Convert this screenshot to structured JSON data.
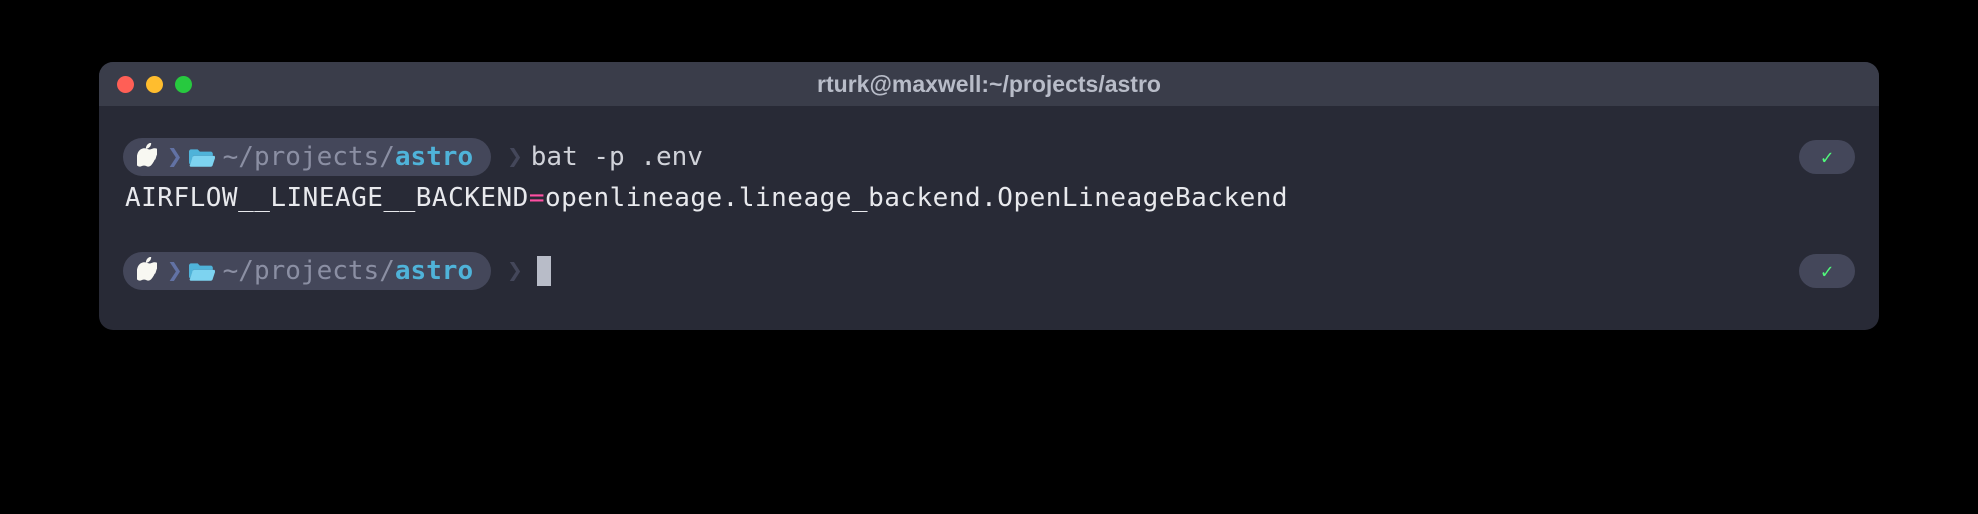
{
  "window": {
    "title": "rturk@maxwell:~/projects/astro"
  },
  "prompt1": {
    "path_prefix": "~/projects/",
    "path_dir": "astro",
    "command": "bat -p .env"
  },
  "output": {
    "var_name": "AIRFLOW__LINEAGE__BACKEND",
    "equals": "=",
    "var_value": "openlineage.lineage_backend.OpenLineageBackend"
  },
  "prompt2": {
    "path_prefix": "~/projects/",
    "path_dir": "astro"
  },
  "status": {
    "check": "✓"
  }
}
